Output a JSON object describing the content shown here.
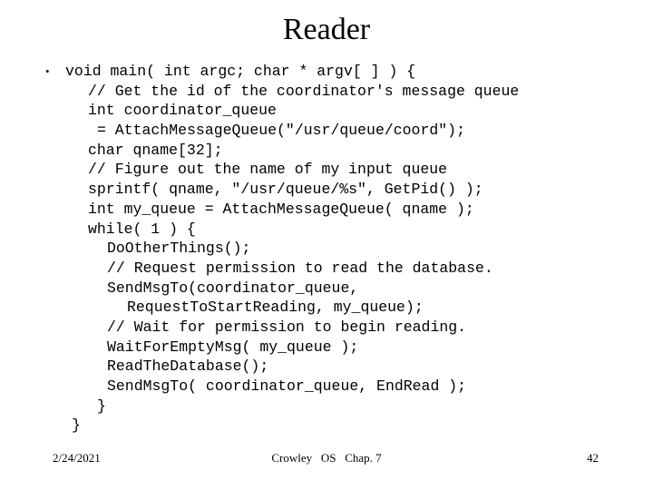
{
  "slide": {
    "title": "Reader",
    "background_color": "#ffffff",
    "text_color": "#000000",
    "bullet_glyph": "•"
  },
  "code": {
    "lines": [
      {
        "indent": 0,
        "bullet": true,
        "text": "void main( int argc; char * argv[ ] ) {"
      },
      {
        "indent": 1,
        "bullet": false,
        "text": "// Get the id of the coordinator's message queue"
      },
      {
        "indent": 1,
        "bullet": false,
        "text": "int coordinator_queue"
      },
      {
        "indent": 2,
        "bullet": false,
        "text": "= AttachMessageQueue(\"/usr/queue/coord\");"
      },
      {
        "indent": 1,
        "bullet": false,
        "text": "char qname[32];"
      },
      {
        "indent": 1,
        "bullet": false,
        "text": "// Figure out the name of my input queue"
      },
      {
        "indent": 1,
        "bullet": false,
        "text": "sprintf( qname, \"/usr/queue/%s\", GetPid() );"
      },
      {
        "indent": 1,
        "bullet": false,
        "text": "int my_queue = AttachMessageQueue( qname );"
      },
      {
        "indent": 1,
        "bullet": false,
        "text": "while( 1 ) {"
      },
      {
        "indent": 3,
        "bullet": false,
        "text": "DoOtherThings();"
      },
      {
        "indent": 3,
        "bullet": false,
        "text": "// Request permission to read the database."
      },
      {
        "indent": 3,
        "bullet": false,
        "text": "SendMsgTo(coordinator_queue,"
      },
      {
        "indent": 4,
        "bullet": false,
        "text": "RequestToStartReading, my_queue);"
      },
      {
        "indent": 3,
        "bullet": false,
        "text": "// Wait for permission to begin reading."
      },
      {
        "indent": 3,
        "bullet": false,
        "text": "WaitForEmptyMsg( my_queue );"
      },
      {
        "indent": 3,
        "bullet": false,
        "text": "ReadTheDatabase();"
      },
      {
        "indent": 3,
        "bullet": false,
        "text": "SendMsgTo( coordinator_queue, EndRead );"
      },
      {
        "indent": 2,
        "bullet": false,
        "text": "}"
      },
      {
        "indent": 5,
        "bullet": false,
        "text": "}"
      }
    ]
  },
  "footer": {
    "date": "2/24/2021",
    "center": "Crowley   OS   Chap. 7",
    "page_number": "42"
  }
}
